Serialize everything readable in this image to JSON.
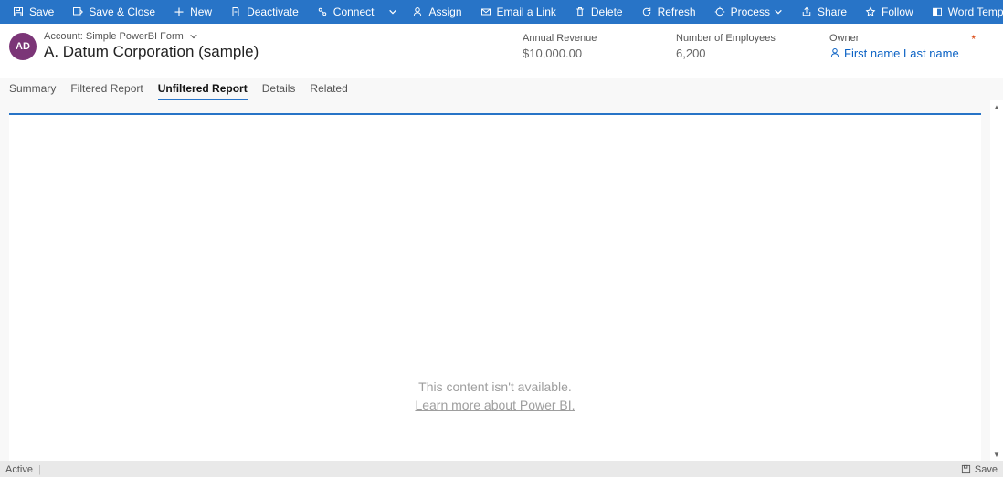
{
  "toolbar": {
    "save": "Save",
    "save_close": "Save & Close",
    "new": "New",
    "deactivate": "Deactivate",
    "connect": "Connect",
    "assign": "Assign",
    "email_link": "Email a Link",
    "delete": "Delete",
    "refresh": "Refresh",
    "process": "Process",
    "share": "Share",
    "follow": "Follow",
    "word_templates": "Word Templates"
  },
  "header": {
    "avatar_initials": "AD",
    "form_label": "Account: Simple PowerBI Form",
    "account_name": "A. Datum Corporation (sample)",
    "fields": {
      "annual_revenue_label": "Annual Revenue",
      "annual_revenue_value": "$10,000.00",
      "num_employees_label": "Number of Employees",
      "num_employees_value": "6,200",
      "owner_label": "Owner",
      "owner_value": "First name Last name"
    }
  },
  "tabs": {
    "summary": "Summary",
    "filtered": "Filtered Report",
    "unfiltered": "Unfiltered Report",
    "details": "Details",
    "related": "Related"
  },
  "content": {
    "unavailable": "This content isn't available.",
    "learn_more": "Learn more about Power BI."
  },
  "statusbar": {
    "status": "Active",
    "save": "Save"
  }
}
